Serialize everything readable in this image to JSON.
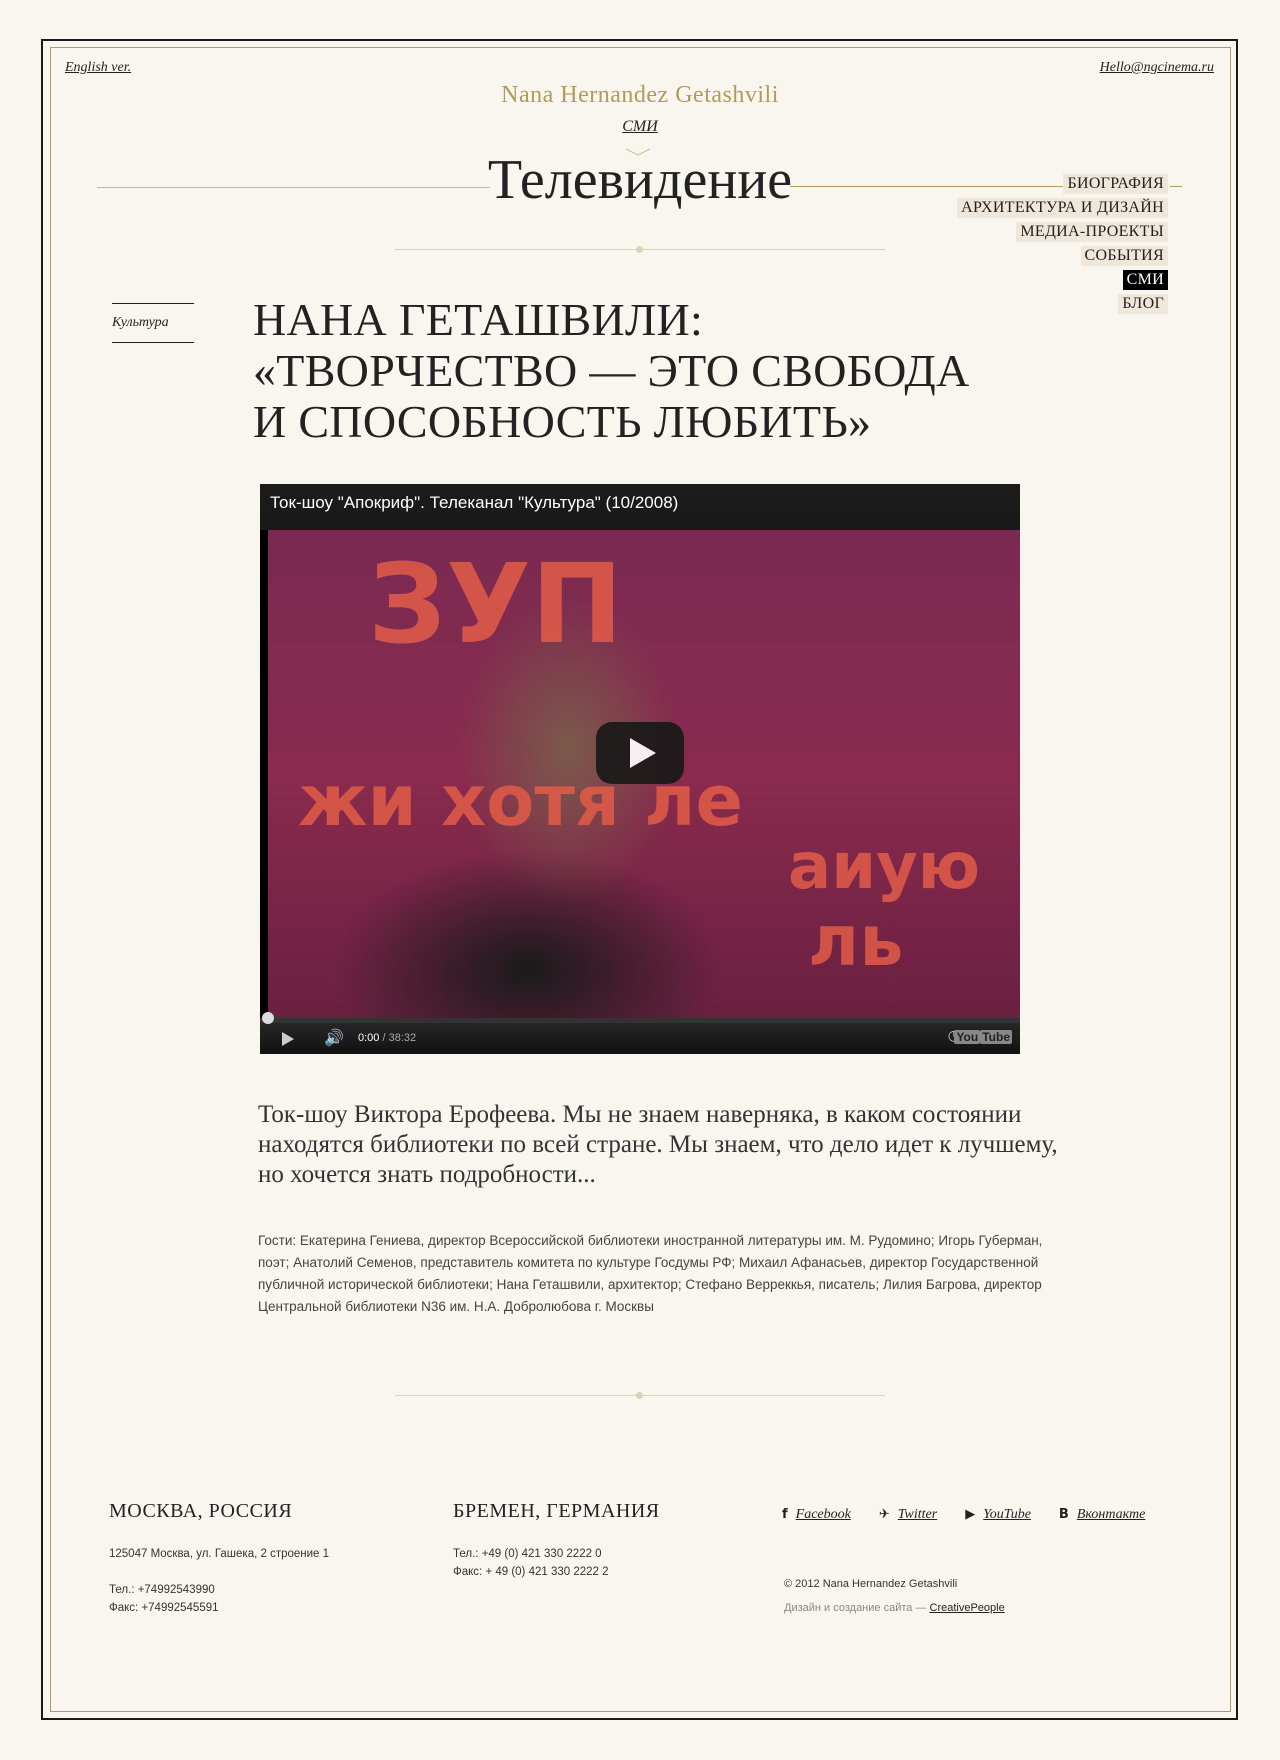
{
  "header": {
    "lang_link": "English ver.",
    "email_link": "Hello@ngcinema.ru",
    "brand": "Nana Hernandez Getashvili",
    "section": "СМИ",
    "page_title": "Телевидение"
  },
  "nav": {
    "items": [
      {
        "label": "БИОГРАФИЯ",
        "active": false
      },
      {
        "label": "АРХИТЕКТУРА И ДИЗАЙН",
        "active": false
      },
      {
        "label": "МЕДИА-ПРОЕКТЫ",
        "active": false
      },
      {
        "label": "СОБЫТИЯ",
        "active": false
      },
      {
        "label": "СМИ",
        "active": true
      },
      {
        "label": "БЛОГ",
        "active": false
      }
    ]
  },
  "article": {
    "category": "Культура",
    "headline_lines": [
      "НАНА ГЕТАШВИЛИ:",
      "«ТВОРЧЕСТВО — ЭТО СВОБОДА",
      "И СПОСОБНОСТЬ ЛЮБИТЬ»"
    ],
    "lead": "Ток-шоу Виктора Ерофеева. Мы не знаем наверняка, в каком состоянии находятся библиотеки по всей стране. Мы знаем, что дело идет к лучшему, но хочется знать подробности...",
    "guests": "Гости: Екатерина Гениева, директор Всероссийской библиотеки иностранной литературы им. М. Рудомино; Игорь Губерман, поэт; Анатолий Семенов, представитель комитета по культуре Госдумы РФ; Михаил Афанасьев, директор Государственной публичной исторической библиотеки; Нана Геташвили, архитектор; Стефано Верреккья, писатель; Лилия Багрова, директор Центральной библиотеки N36 им. Н.А. Добролюбова г. Москвы"
  },
  "video": {
    "title": "Ток-шоу \"Апокриф\". Телеканал \"Культура\" (10/2008)",
    "current_time": "0:00",
    "duration": "/ 38:32",
    "progress": 0,
    "youtube_label": "You",
    "youtube_tube": "Tube"
  },
  "footer": {
    "moscow": {
      "city": "МОСКВА, РОССИЯ",
      "address": "125047 Москва, ул. Гашека, 2 строение 1",
      "phone": "Тел.: +74992543990",
      "fax": "Факс: +74992545591"
    },
    "bremen": {
      "city": "БРЕМЕН, ГЕРМАНИЯ",
      "phone": "Тел.: +49 (0) 421 330 2222 0",
      "fax": "Факс: + 49 (0) 421 330 2222 2"
    },
    "socials": [
      {
        "label": "Facebook",
        "icon": "f",
        "name": "facebook"
      },
      {
        "label": "Twitter",
        "icon": "🐦",
        "name": "twitter"
      },
      {
        "label": "YouTube",
        "icon": "▶",
        "name": "youtube"
      },
      {
        "label": "Вконтакте",
        "icon": "В",
        "name": "vkontakte"
      }
    ],
    "copyright": "© 2012 Nana Hernandez Getashvili",
    "credit_prefix": "Дизайн и создание сайта —",
    "credit_link": "CreativePeople"
  }
}
